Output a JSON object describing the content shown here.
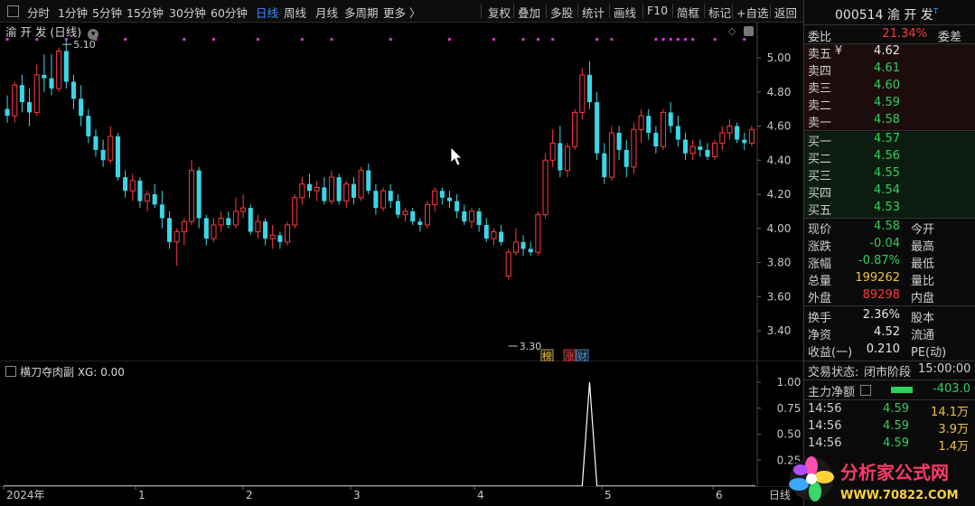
{
  "toolbar": {
    "periods": [
      "分时",
      "1分钟",
      "5分钟",
      "15分钟",
      "30分钟",
      "60分钟",
      "日线",
      "周线",
      "月线",
      "多周期",
      "更多 〉"
    ],
    "active_index": 6,
    "tools": [
      "复权",
      "叠加",
      "多股",
      "统计",
      "画线",
      "F10",
      "简框",
      "标记",
      "+自选",
      "返回"
    ]
  },
  "chart": {
    "title": "渝 开 发 (日线)",
    "high_label": "5.10",
    "low_label": "3.30",
    "price_ticks": [
      "5.00",
      "4.80",
      "4.60",
      "4.40",
      "4.20",
      "4.00",
      "3.80",
      "3.60",
      "3.40"
    ],
    "badges": [
      "榜",
      "涨",
      "财"
    ],
    "indicator_title": "横刀夺肉副  XG: 0.00",
    "indicator_ticks": [
      "1.00",
      "0.75",
      "0.50",
      "0.25"
    ],
    "date_labels": [
      "2024年",
      "1",
      "2",
      "3",
      "4",
      "5",
      "6"
    ],
    "date_axis_right": "日线"
  },
  "chart_data": [
    {
      "type": "candlestick",
      "title": "渝 开 发 (日线)",
      "ylim": [
        3.25,
        5.2
      ],
      "y_ticks": [
        3.4,
        3.6,
        3.8,
        4.0,
        4.2,
        4.4,
        4.6,
        4.8,
        5.0
      ],
      "x_period_labels": [
        "2024年",
        "1",
        "2",
        "3",
        "4",
        "5",
        "6"
      ],
      "colors": {
        "up": "#ff3b3b",
        "down": "#3ad6e8"
      },
      "candles": [
        [
          4.7,
          4.78,
          4.62,
          4.66
        ],
        [
          4.66,
          4.86,
          4.62,
          4.84
        ],
        [
          4.84,
          4.9,
          4.68,
          4.74
        ],
        [
          4.74,
          4.82,
          4.6,
          4.68
        ],
        [
          4.68,
          4.96,
          4.66,
          4.9
        ],
        [
          4.9,
          5.02,
          4.8,
          4.88
        ],
        [
          4.88,
          5.02,
          4.78,
          4.82
        ],
        [
          4.82,
          5.06,
          4.8,
          5.04
        ],
        [
          5.04,
          5.1,
          4.82,
          4.86
        ],
        [
          4.86,
          4.9,
          4.7,
          4.76
        ],
        [
          4.76,
          4.84,
          4.6,
          4.66
        ],
        [
          4.66,
          4.7,
          4.5,
          4.54
        ],
        [
          4.54,
          4.58,
          4.42,
          4.46
        ],
        [
          4.46,
          4.52,
          4.36,
          4.4
        ],
        [
          4.4,
          4.6,
          4.38,
          4.54
        ],
        [
          4.54,
          4.56,
          4.28,
          4.3
        ],
        [
          4.3,
          4.34,
          4.18,
          4.22
        ],
        [
          4.22,
          4.32,
          4.16,
          4.28
        ],
        [
          4.28,
          4.3,
          4.12,
          4.16
        ],
        [
          4.16,
          4.22,
          4.1,
          4.2
        ],
        [
          4.2,
          4.26,
          4.12,
          4.14
        ],
        [
          4.14,
          4.22,
          4.0,
          4.06
        ],
        [
          4.06,
          4.1,
          3.88,
          3.92
        ],
        [
          3.92,
          4.0,
          3.78,
          3.98
        ],
        [
          3.98,
          4.06,
          3.9,
          4.04
        ],
        [
          4.04,
          4.4,
          4.02,
          4.34
        ],
        [
          4.34,
          4.36,
          4.0,
          4.06
        ],
        [
          4.06,
          4.08,
          3.9,
          3.94
        ],
        [
          3.94,
          4.06,
          3.92,
          4.02
        ],
        [
          4.02,
          4.1,
          3.98,
          4.06
        ],
        [
          4.06,
          4.1,
          4.0,
          4.02
        ],
        [
          4.02,
          4.18,
          4.0,
          4.1
        ],
        [
          4.1,
          4.2,
          4.06,
          4.12
        ],
        [
          4.12,
          4.14,
          3.96,
          3.98
        ],
        [
          3.98,
          4.08,
          3.94,
          4.04
        ],
        [
          4.04,
          4.06,
          3.9,
          3.94
        ],
        [
          3.94,
          4.02,
          3.88,
          3.96
        ],
        [
          3.96,
          3.98,
          3.88,
          3.92
        ],
        [
          3.92,
          4.04,
          3.9,
          4.02
        ],
        [
          4.02,
          4.2,
          4.0,
          4.18
        ],
        [
          4.18,
          4.3,
          4.14,
          4.26
        ],
        [
          4.26,
          4.32,
          4.18,
          4.22
        ],
        [
          4.22,
          4.28,
          4.16,
          4.24
        ],
        [
          4.24,
          4.3,
          4.14,
          4.16
        ],
        [
          4.16,
          4.34,
          4.14,
          4.3
        ],
        [
          4.3,
          4.32,
          4.14,
          4.16
        ],
        [
          4.16,
          4.28,
          4.12,
          4.26
        ],
        [
          4.26,
          4.3,
          4.14,
          4.18
        ],
        [
          4.18,
          4.36,
          4.16,
          4.34
        ],
        [
          4.34,
          4.38,
          4.2,
          4.22
        ],
        [
          4.22,
          4.26,
          4.08,
          4.12
        ],
        [
          4.12,
          4.24,
          4.1,
          4.22
        ],
        [
          4.22,
          4.26,
          4.12,
          4.16
        ],
        [
          4.16,
          4.2,
          4.06,
          4.08
        ],
        [
          4.08,
          4.12,
          4.04,
          4.1
        ],
        [
          4.1,
          4.12,
          4.02,
          4.04
        ],
        [
          4.04,
          4.06,
          3.98,
          4.02
        ],
        [
          4.02,
          4.16,
          4.0,
          4.14
        ],
        [
          4.14,
          4.24,
          4.1,
          4.22
        ],
        [
          4.22,
          4.24,
          4.14,
          4.18
        ],
        [
          4.18,
          4.22,
          4.12,
          4.16
        ],
        [
          4.16,
          4.2,
          4.06,
          4.1
        ],
        [
          4.1,
          4.14,
          4.02,
          4.04
        ],
        [
          4.04,
          4.12,
          4.0,
          4.1
        ],
        [
          4.1,
          4.12,
          3.98,
          4.02
        ],
        [
          4.02,
          4.06,
          3.92,
          3.94
        ],
        [
          3.94,
          4.0,
          3.9,
          3.98
        ],
        [
          3.98,
          4.02,
          3.9,
          3.92
        ],
        [
          3.72,
          3.88,
          3.7,
          3.86
        ],
        [
          3.86,
          4.0,
          3.84,
          3.92
        ],
        [
          3.92,
          3.96,
          3.84,
          3.88
        ],
        [
          3.88,
          3.92,
          3.84,
          3.86
        ],
        [
          3.86,
          4.1,
          3.84,
          4.08
        ],
        [
          4.08,
          4.44,
          4.06,
          4.4
        ],
        [
          4.4,
          4.58,
          4.36,
          4.5
        ],
        [
          4.5,
          4.6,
          4.3,
          4.34
        ],
        [
          4.34,
          4.5,
          4.3,
          4.48
        ],
        [
          4.48,
          4.7,
          4.46,
          4.68
        ],
        [
          4.68,
          4.94,
          4.64,
          4.9
        ],
        [
          4.9,
          4.98,
          4.7,
          4.74
        ],
        [
          4.74,
          4.8,
          4.4,
          4.44
        ],
        [
          4.44,
          4.5,
          4.26,
          4.3
        ],
        [
          4.3,
          4.6,
          4.28,
          4.56
        ],
        [
          4.56,
          4.6,
          4.4,
          4.46
        ],
        [
          4.46,
          4.52,
          4.3,
          4.36
        ],
        [
          4.36,
          4.62,
          4.32,
          4.58
        ],
        [
          4.58,
          4.7,
          4.5,
          4.66
        ],
        [
          4.66,
          4.7,
          4.52,
          4.56
        ],
        [
          4.56,
          4.6,
          4.44,
          4.48
        ],
        [
          4.48,
          4.7,
          4.46,
          4.68
        ],
        [
          4.68,
          4.74,
          4.56,
          4.6
        ],
        [
          4.6,
          4.66,
          4.48,
          4.52
        ],
        [
          4.52,
          4.56,
          4.4,
          4.44
        ],
        [
          4.44,
          4.52,
          4.4,
          4.48
        ],
        [
          4.48,
          4.52,
          4.42,
          4.46
        ],
        [
          4.46,
          4.5,
          4.4,
          4.42
        ],
        [
          4.42,
          4.52,
          4.4,
          4.5
        ],
        [
          4.5,
          4.6,
          4.46,
          4.56
        ],
        [
          4.56,
          4.64,
          4.52,
          4.6
        ],
        [
          4.6,
          4.62,
          4.5,
          4.52
        ],
        [
          4.52,
          4.56,
          4.46,
          4.5
        ],
        [
          4.5,
          4.6,
          4.48,
          4.58
        ]
      ]
    },
    {
      "type": "line",
      "title": "横刀夺肉副",
      "ylim": [
        0,
        1
      ],
      "y_ticks": [
        0.25,
        0.5,
        0.75,
        1.0
      ],
      "series": [
        {
          "name": "XG",
          "spike_at_index": 79,
          "spike_value": 1.0,
          "baseline": 0.0,
          "current": 0.0
        }
      ]
    }
  ],
  "quote": {
    "code": "000514",
    "name": "渝 开 发",
    "weibi_label": "委比",
    "weibi_value": "21.34%",
    "weicha_label": "委差",
    "asks": [
      {
        "label": "卖五",
        "price": "4.62",
        "mark": "¥"
      },
      {
        "label": "卖四",
        "price": "4.61"
      },
      {
        "label": "卖三",
        "price": "4.60"
      },
      {
        "label": "卖二",
        "price": "4.59"
      },
      {
        "label": "卖一",
        "price": "4.58"
      }
    ],
    "bids": [
      {
        "label": "买一",
        "price": "4.57"
      },
      {
        "label": "买二",
        "price": "4.56"
      },
      {
        "label": "买三",
        "price": "4.55"
      },
      {
        "label": "买四",
        "price": "4.54"
      },
      {
        "label": "买五",
        "price": "4.53"
      }
    ],
    "stats": [
      {
        "label": "现价",
        "value": "4.58",
        "label2": "今开",
        "cls": "green"
      },
      {
        "label": "涨跌",
        "value": "-0.04",
        "label2": "最高",
        "cls": "green"
      },
      {
        "label": "涨幅",
        "value": "-0.87%",
        "label2": "最低",
        "cls": "green"
      },
      {
        "label": "总量",
        "value": "199262",
        "label2": "量比",
        "cls": "yellow"
      },
      {
        "label": "外盘",
        "value": "89298",
        "label2": "内盘",
        "cls": "red"
      }
    ],
    "stats2": [
      {
        "label": "换手",
        "value": "2.36%",
        "label2": "股本",
        "cls": "white"
      },
      {
        "label": "净资",
        "value": "4.52",
        "label2": "流通",
        "cls": "white"
      },
      {
        "label": "收益(一)",
        "value": "0.210",
        "label2": "PE(动)",
        "cls": "white"
      }
    ],
    "status_label": "交易状态:",
    "status_value": "闭市阶段",
    "status_time": "15:00:00",
    "flow_label": "主力净额",
    "flow_value": "-403.0",
    "ticks": [
      {
        "time": "14:56",
        "price": "4.59",
        "vol": "14.1万"
      },
      {
        "time": "14:56",
        "price": "4.59",
        "vol": "3.9万"
      },
      {
        "time": "14:56",
        "price": "4.59",
        "vol": "1.4万"
      }
    ]
  },
  "watermark": {
    "title": "分析家公式网",
    "url": "WWW.70822.COM"
  }
}
